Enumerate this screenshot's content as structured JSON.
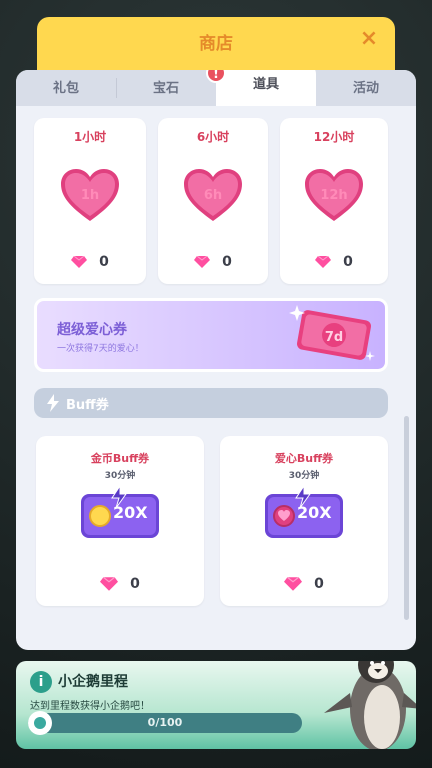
{
  "header": {
    "title": "商店",
    "close_icon": "×"
  },
  "tabs": [
    {
      "label": "礼包",
      "active": false
    },
    {
      "label": "宝石",
      "active": false,
      "badge": "!"
    },
    {
      "label": "道具",
      "active": true
    },
    {
      "label": "活动",
      "active": false
    }
  ],
  "time_items": [
    {
      "title": "1小时",
      "heart_label": "1h",
      "price": "0"
    },
    {
      "title": "6小时",
      "heart_label": "6h",
      "price": "0"
    },
    {
      "title": "12小时",
      "heart_label": "12h",
      "price": "0"
    }
  ],
  "super": {
    "title": "超级爱心券",
    "subtitle": "一次获得7天的爱心！",
    "ticket_label": "7d"
  },
  "buff_section": {
    "title": "Buff券"
  },
  "buff_items": [
    {
      "title": "金币Buff券",
      "duration": "30分钟",
      "multiplier": "20X",
      "price": "0"
    },
    {
      "title": "爱心Buff券",
      "duration": "30分钟",
      "multiplier": "20X",
      "price": "0"
    }
  ],
  "milestone": {
    "title": "小企鹅里程",
    "subtitle": "达到里程数获得小企鹅吧！",
    "progress_text": "0/100",
    "progress_fraction": 0
  },
  "colors": {
    "header": "#ffd84f",
    "accent_red": "#d8415e",
    "gem_pink": "#ff4fa0",
    "ticket_purple": "#8c62f0"
  }
}
